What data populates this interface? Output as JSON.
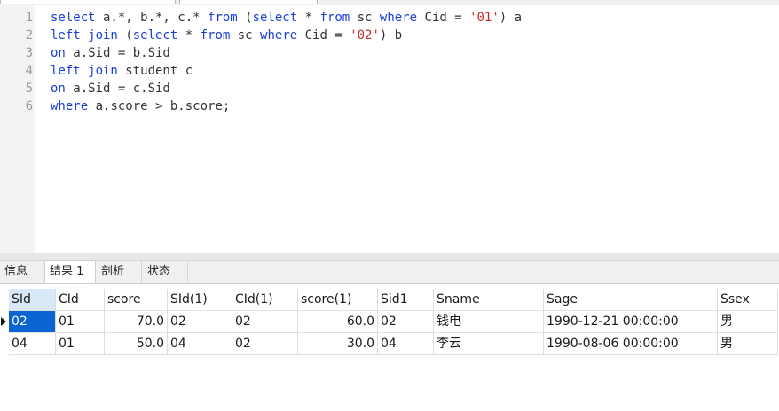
{
  "editor": {
    "lines": [
      {
        "num": "1",
        "tokens": [
          {
            "t": "select",
            "c": "kw"
          },
          {
            "t": " a.*, b.*, c.* ",
            "c": ""
          },
          {
            "t": "from",
            "c": "kw"
          },
          {
            "t": " (",
            "c": ""
          },
          {
            "t": "select",
            "c": "kw"
          },
          {
            "t": " * ",
            "c": ""
          },
          {
            "t": "from",
            "c": "kw"
          },
          {
            "t": " sc ",
            "c": ""
          },
          {
            "t": "where",
            "c": "kw"
          },
          {
            "t": " Cid = ",
            "c": ""
          },
          {
            "t": "'01'",
            "c": "str"
          },
          {
            "t": ") a",
            "c": ""
          }
        ]
      },
      {
        "num": "2",
        "tokens": [
          {
            "t": "left join",
            "c": "kw"
          },
          {
            "t": " (",
            "c": ""
          },
          {
            "t": "select",
            "c": "kw"
          },
          {
            "t": " * ",
            "c": ""
          },
          {
            "t": "from",
            "c": "kw"
          },
          {
            "t": " sc ",
            "c": ""
          },
          {
            "t": "where",
            "c": "kw"
          },
          {
            "t": " Cid = ",
            "c": ""
          },
          {
            "t": "'02'",
            "c": "str"
          },
          {
            "t": ") b",
            "c": ""
          }
        ]
      },
      {
        "num": "3",
        "tokens": [
          {
            "t": "on",
            "c": "kw"
          },
          {
            "t": " a.Sid = b.Sid",
            "c": ""
          }
        ]
      },
      {
        "num": "4",
        "tokens": [
          {
            "t": "left join",
            "c": "kw"
          },
          {
            "t": " student c",
            "c": ""
          }
        ]
      },
      {
        "num": "5",
        "tokens": [
          {
            "t": "on",
            "c": "kw"
          },
          {
            "t": " a.Sid = c.Sid",
            "c": ""
          }
        ]
      },
      {
        "num": "6",
        "tokens": [
          {
            "t": "where",
            "c": "kw"
          },
          {
            "t": " a.score > b.score;",
            "c": ""
          }
        ]
      }
    ]
  },
  "result_tabs": [
    {
      "label": "信息",
      "active": false
    },
    {
      "label": "结果 1",
      "active": true
    },
    {
      "label": "剖析",
      "active": false
    },
    {
      "label": "状态",
      "active": false
    }
  ],
  "grid": {
    "columns": [
      "SId",
      "CId",
      "score",
      "SId(1)",
      "CId(1)",
      "score(1)",
      "Sid1",
      "Sname",
      "Sage",
      "Ssex"
    ],
    "rows": [
      [
        "02",
        "01",
        "70.0",
        "02",
        "02",
        "60.0",
        "02",
        "钱电",
        "1990-12-21 00:00:00",
        "男"
      ],
      [
        "04",
        "01",
        "50.0",
        "04",
        "02",
        "30.0",
        "04",
        "李云",
        "1990-08-06 00:00:00",
        "男"
      ]
    ],
    "numeric_columns": [
      2,
      5
    ],
    "selected_cell": [
      0,
      0
    ]
  },
  "colors": {
    "keyword": "#1a3fd6",
    "string": "#c22b2b",
    "selection": "#0a64d2"
  }
}
